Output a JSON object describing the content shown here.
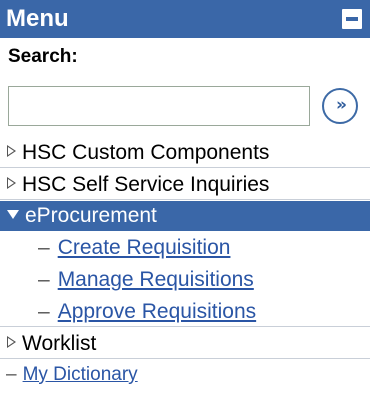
{
  "menu": {
    "title": "Menu",
    "search": {
      "label": "Search:",
      "value": "",
      "placeholder": "",
      "go_symbol": "»"
    },
    "items": [
      {
        "label": "HSC Custom Components",
        "state": "collapsed"
      },
      {
        "label": "HSC Self Service Inquiries",
        "state": "collapsed"
      },
      {
        "label": "eProcurement",
        "state": "expanded",
        "children": [
          {
            "label": "Create Requisition"
          },
          {
            "label": "Manage Requisitions"
          },
          {
            "label": "Approve Requisitions"
          }
        ]
      },
      {
        "label": "Worklist",
        "state": "collapsed"
      },
      {
        "label": "My Dictionary",
        "state": "link"
      }
    ]
  },
  "colors": {
    "header_bg": "#3a67a8",
    "selected_bg": "#3a67a8",
    "link": "#2a55a5",
    "text": "#000000"
  }
}
